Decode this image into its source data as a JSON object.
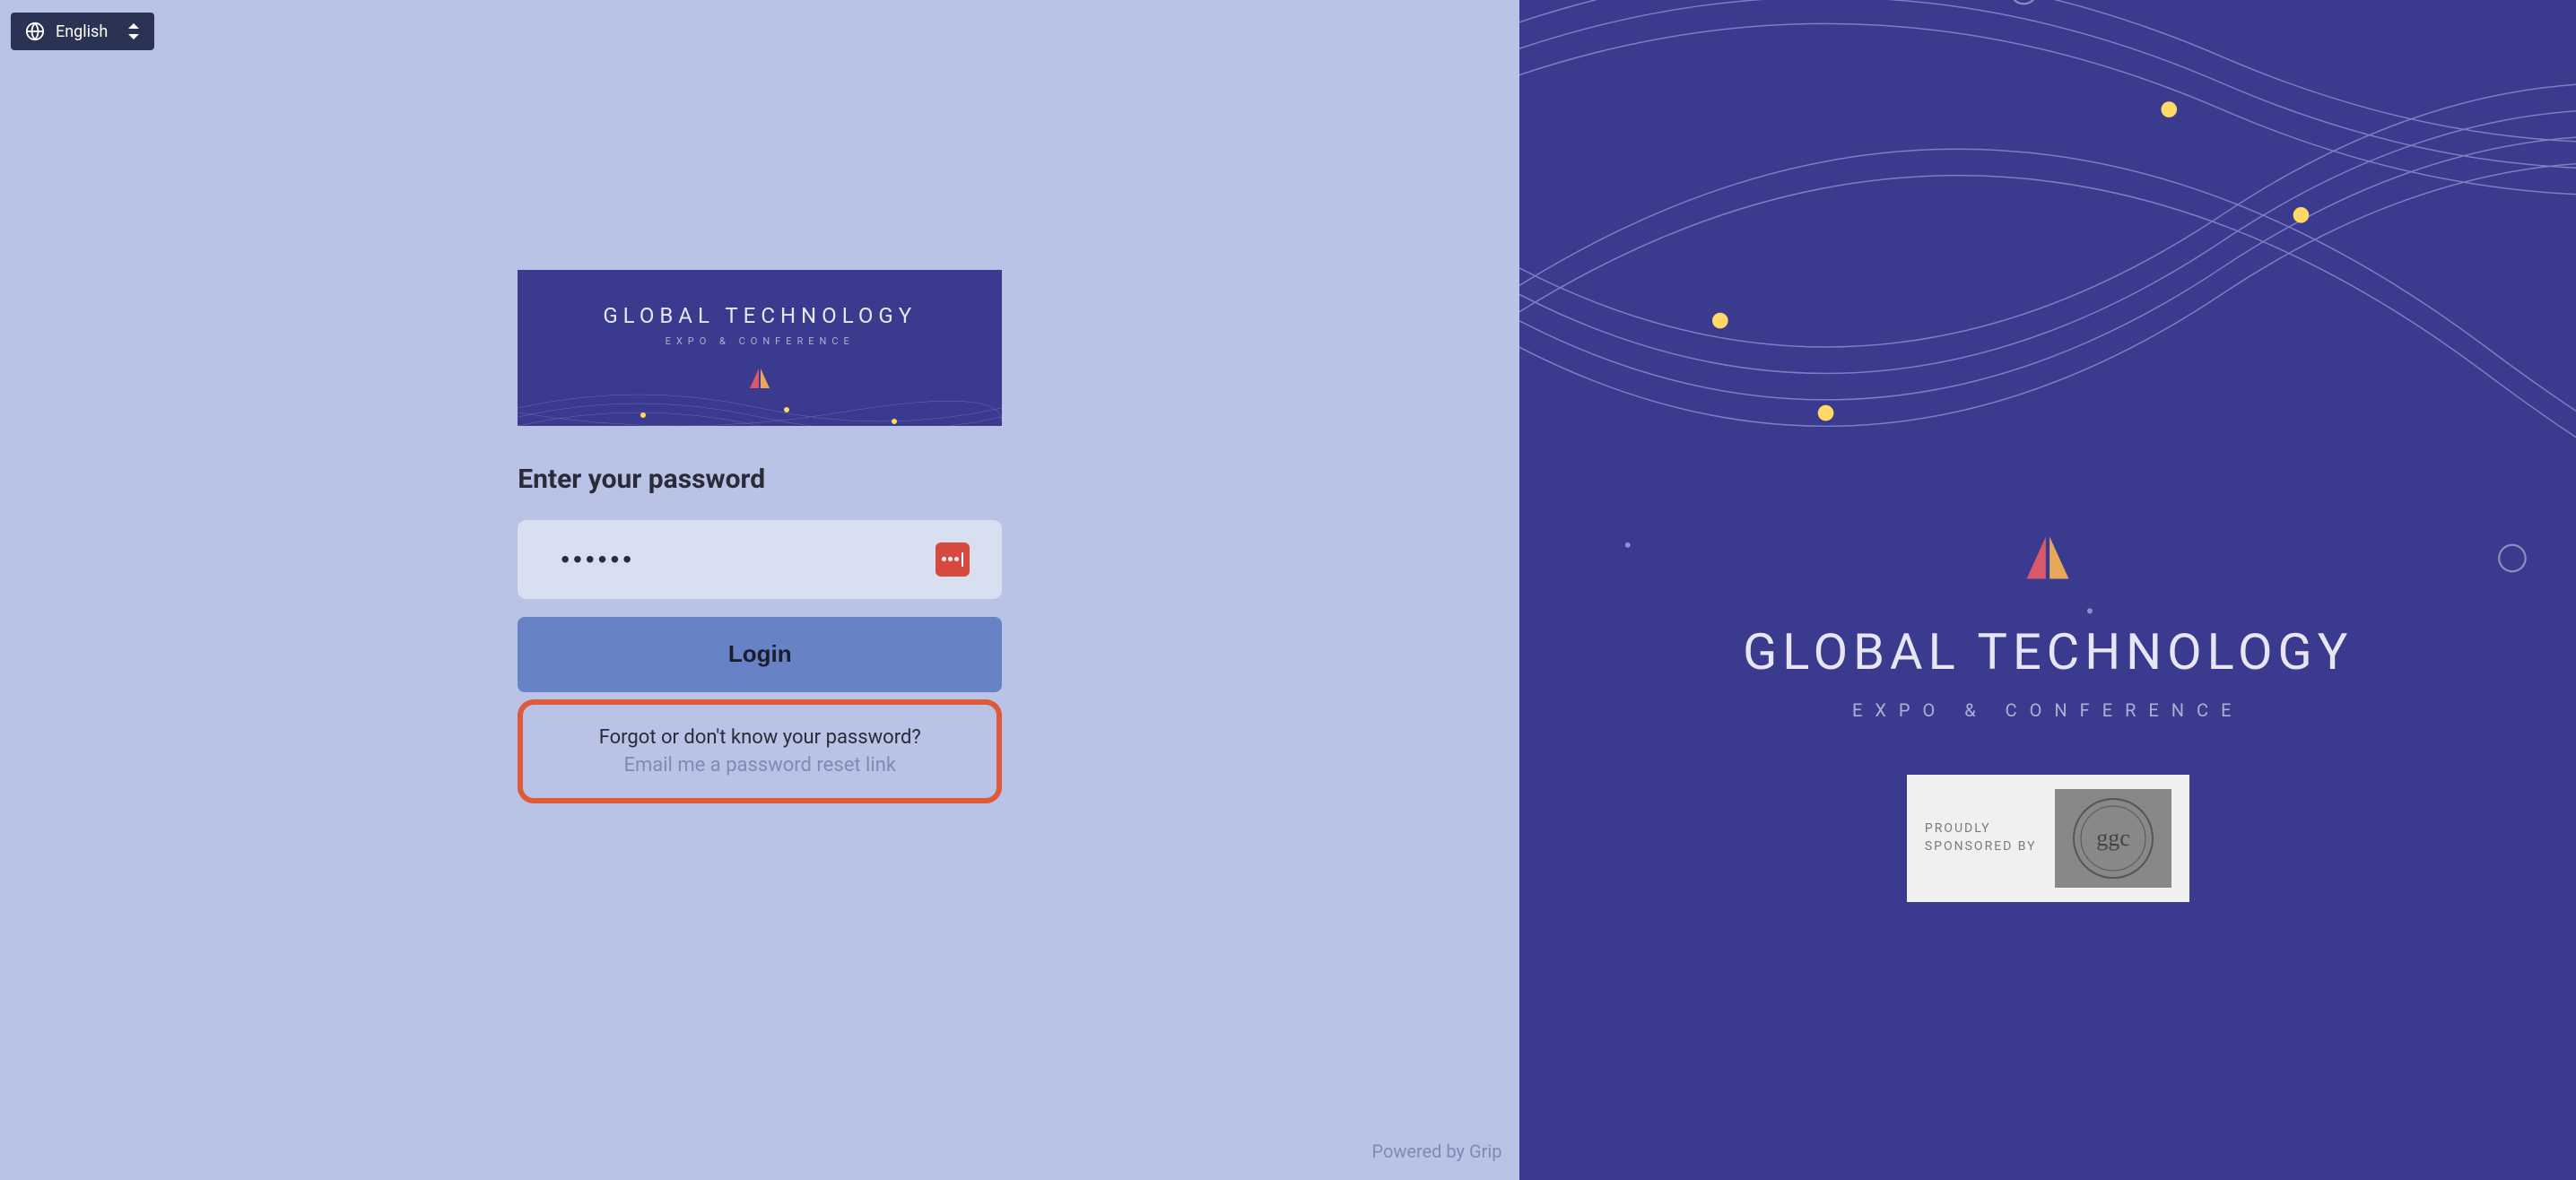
{
  "language": {
    "current": "English"
  },
  "banner": {
    "title": "GLOBAL TECHNOLOGY",
    "subtitle": "EXPO & CONFERENCE"
  },
  "heading": "Enter your password",
  "password": {
    "value": "••••••"
  },
  "login_button_label": "Login",
  "reset": {
    "question": "Forgot or don't know your password?",
    "link": "Email me a password reset link"
  },
  "footer": {
    "powered_by": "Powered by Grip"
  },
  "right": {
    "title": "GLOBAL TECHNOLOGY",
    "subtitle": "EXPO & CONFERENCE",
    "sponsor_label": "PROUDLY\nSPONSORED BY",
    "sponsor_name": "ggc"
  },
  "colors": {
    "left_bg": "#b8c3e6",
    "right_bg": "#3a3a8f",
    "accent_orange": "#df5a3a",
    "button_bg": "#6882c6"
  }
}
